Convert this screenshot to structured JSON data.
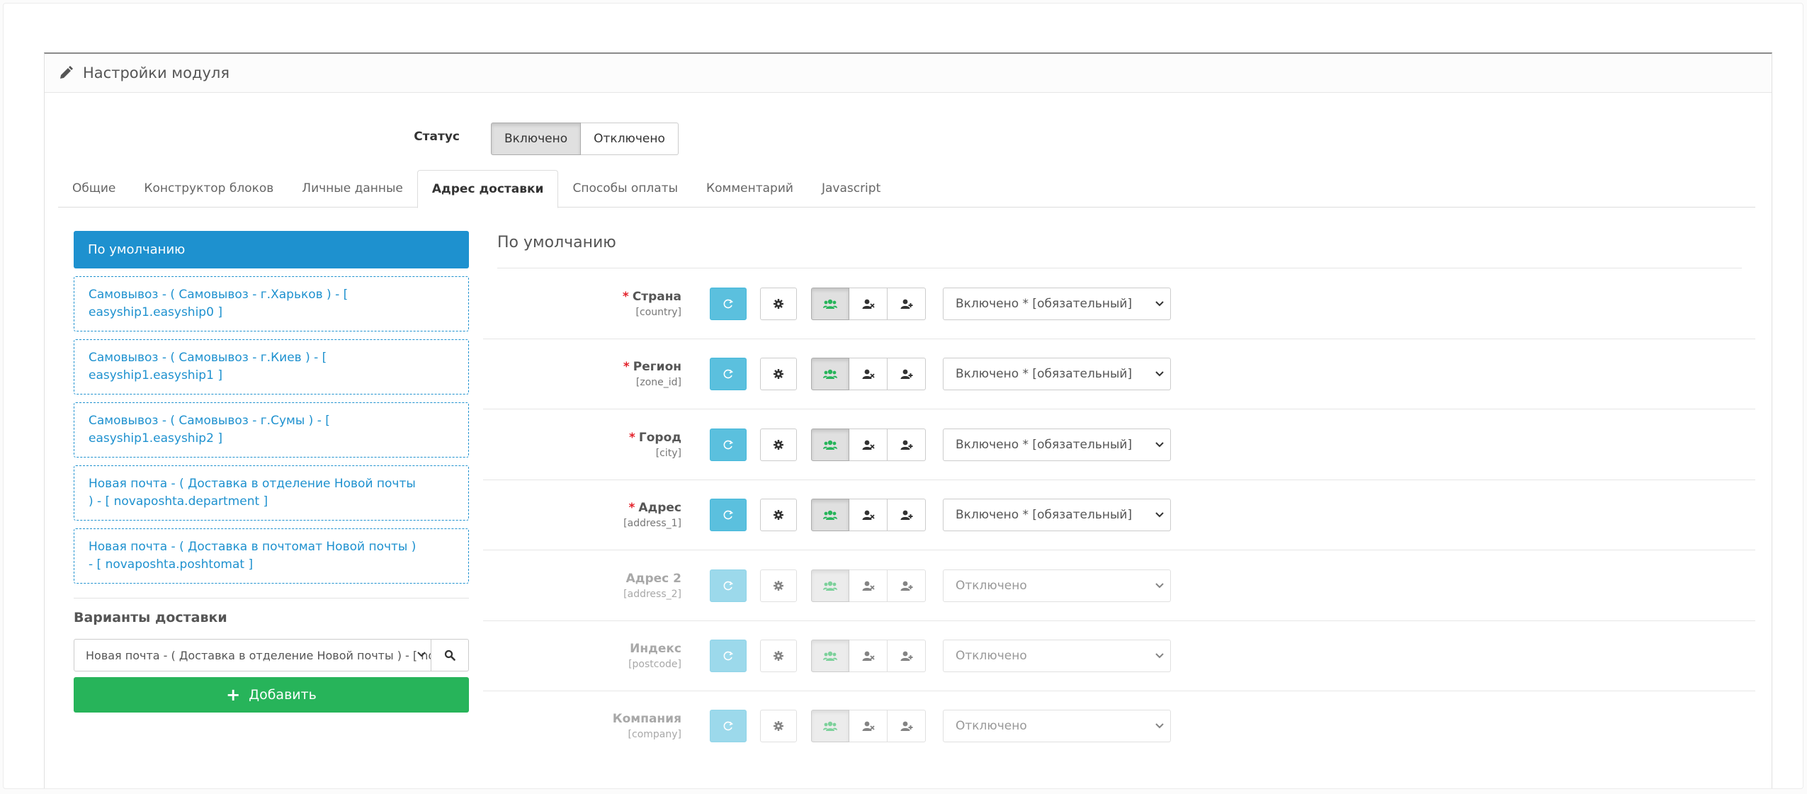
{
  "panel": {
    "title": "Настройки модуля"
  },
  "status": {
    "label": "Статус",
    "on": "Включено",
    "off": "Отключено"
  },
  "tabs": [
    "Общие",
    "Конструктор блоков",
    "Личные данные",
    "Адрес доставки",
    "Способы оплаты",
    "Комментарий",
    "Javascript"
  ],
  "active_tab": "Адрес доставки",
  "sidebar": {
    "default": "По умолчанию",
    "items": [
      {
        "line1": "Самовывоз - ( Самовывоз - г.Харьков ) - [",
        "line2": "easyship1.easyship0 ]"
      },
      {
        "line1": "Самовывоз - ( Самовывоз - г.Киев ) - [",
        "line2": "easyship1.easyship1 ]"
      },
      {
        "line1": "Самовывоз - ( Самовывоз - г.Сумы ) - [",
        "line2": "easyship1.easyship2 ]"
      },
      {
        "line1": "Новая почта - ( Доставка в отделение Новой почты",
        "line2": ") - [ novaposhta.department ]"
      },
      {
        "line1": "Новая почта - ( Доставка в почтомат Новой почты )",
        "line2": "- [ novaposhta.poshtomat ]"
      }
    ],
    "variants_title": "Варианты доставки",
    "variants_select": "Новая почта - ( Доставка в отделение Новой почты ) - [ no",
    "add_label": "Добавить"
  },
  "content": {
    "title": "По умолчанию",
    "fields": [
      {
        "name": "Страна",
        "key": "[country]",
        "required": "*",
        "select": "Включено * [обязательный]"
      },
      {
        "name": "Регион",
        "key": "[zone_id]",
        "required": "*",
        "select": "Включено * [обязательный]"
      },
      {
        "name": "Город",
        "key": "[city]",
        "required": "*",
        "select": "Включено * [обязательный]"
      },
      {
        "name": "Адрес",
        "key": "[address_1]",
        "required": "*",
        "select": "Включено * [обязательный]"
      },
      {
        "name": "Адрес 2",
        "key": "[address_2]",
        "required": "",
        "select": "Отключено"
      },
      {
        "name": "Индекс",
        "key": "[postcode]",
        "required": "",
        "select": "Отключено"
      },
      {
        "name": "Компания",
        "key": "[company]",
        "required": "",
        "select": "Отключено"
      }
    ]
  },
  "colors": {
    "primary": "#1e91cf",
    "info": "#5bc0de",
    "success": "#27b45a",
    "required": "#e3212a",
    "users_icon": "#27b45a"
  },
  "icons": {
    "header": "pencil-icon",
    "search": "search-icon",
    "add": "plus-icon",
    "row_buttons": [
      "circle-arrow-icon",
      "gear-icon",
      "users-icon",
      "user-remove-icon",
      "user-add-icon"
    ]
  }
}
